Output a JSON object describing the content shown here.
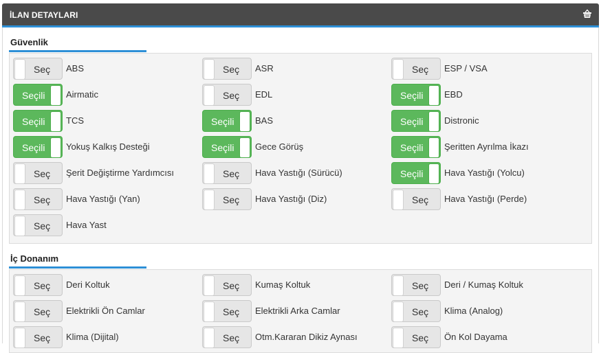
{
  "header": {
    "title": "İLAN DETAYLARI",
    "icon": "basket-icon"
  },
  "colors": {
    "header_bg": "#4a4a4a",
    "accent": "#2d8fd6",
    "selected": "#5cb85c",
    "unselected": "#e6e6e6"
  },
  "toggle_labels": {
    "on": "Seçili",
    "off": "Seç"
  },
  "sections": [
    {
      "title": "Güvenlik",
      "items": [
        {
          "label": "ABS",
          "selected": false
        },
        {
          "label": "ASR",
          "selected": false
        },
        {
          "label": "ESP / VSA",
          "selected": false
        },
        {
          "label": "Airmatic",
          "selected": true
        },
        {
          "label": "EDL",
          "selected": false
        },
        {
          "label": "EBD",
          "selected": true
        },
        {
          "label": "TCS",
          "selected": true
        },
        {
          "label": "BAS",
          "selected": true
        },
        {
          "label": "Distronic",
          "selected": true
        },
        {
          "label": "Yokuş Kalkış Desteği",
          "selected": true
        },
        {
          "label": "Gece Görüş",
          "selected": true
        },
        {
          "label": "Şeritten Ayrılma İkazı",
          "selected": true
        },
        {
          "label": "Şerit Değiştirme Yardımcısı",
          "selected": false
        },
        {
          "label": "Hava Yastığı (Sürücü)",
          "selected": false
        },
        {
          "label": "Hava Yastığı (Yolcu)",
          "selected": true
        },
        {
          "label": "Hava Yastığı (Yan)",
          "selected": false
        },
        {
          "label": "Hava Yastığı (Diz)",
          "selected": false
        },
        {
          "label": "Hava Yastığı (Perde)",
          "selected": false
        },
        {
          "label": "Hava Yast",
          "selected": false
        }
      ]
    },
    {
      "title": "İç Donanım",
      "items": [
        {
          "label": "Deri Koltuk",
          "selected": false
        },
        {
          "label": "Kumaş Koltuk",
          "selected": false
        },
        {
          "label": "Deri / Kumaş Koltuk",
          "selected": false
        },
        {
          "label": "Elektrikli Ön Camlar",
          "selected": false
        },
        {
          "label": "Elektrikli Arka Camlar",
          "selected": false
        },
        {
          "label": "Klima (Analog)",
          "selected": false
        },
        {
          "label": "Klima (Dijital)",
          "selected": false
        },
        {
          "label": "Otm.Kararan Dikiz Aynası",
          "selected": false
        },
        {
          "label": "Ön Kol Dayama",
          "selected": false
        }
      ]
    }
  ]
}
